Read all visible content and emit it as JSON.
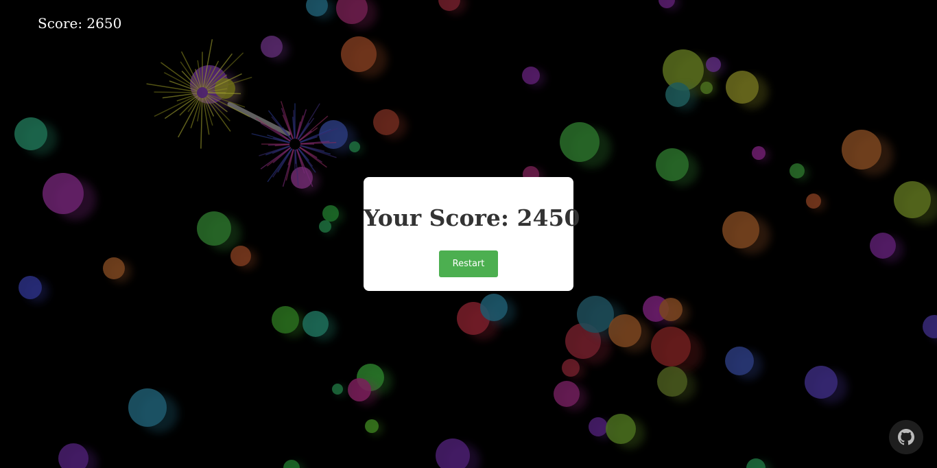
{
  "hud": {
    "score_text": "Score: 2650"
  },
  "game_over": {
    "title": "Your Score: 2450",
    "restart_label": "Restart"
  },
  "github": {
    "icon": "github-icon"
  }
}
